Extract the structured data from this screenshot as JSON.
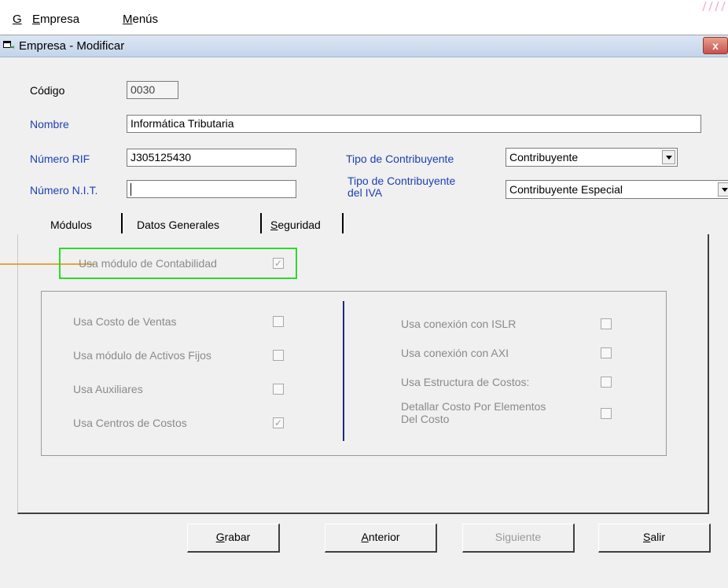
{
  "menu": {
    "items": [
      {
        "label": "G",
        "underline": "G",
        "rest": ""
      },
      {
        "label": "Empresa",
        "underline": "E",
        "rest": "mpresa"
      },
      {
        "label": "Menús",
        "underline": "M",
        "rest": "enús"
      }
    ]
  },
  "window": {
    "title": "Empresa - Modificar",
    "close_label": "x"
  },
  "form": {
    "codigo_label": "Código",
    "codigo_value": "0030",
    "nombre_label": "Nombre",
    "nombre_value": "Informática Tributaria",
    "rif_label": "Número RIF",
    "rif_value": "J305125430",
    "nit_label": "Número N.I.T.",
    "nit_value": "",
    "tipo_contribuyente_label": "Tipo de Contribuyente",
    "tipo_contribuyente_value": "Contribuyente",
    "tipo_iva_label_1": "Tipo de Contribuyente",
    "tipo_iva_label_2": "del IVA",
    "tipo_iva_value": "Contribuyente Especial"
  },
  "tabs": [
    {
      "label": "Módulos",
      "active": true
    },
    {
      "label": "Datos Generales",
      "active": false
    },
    {
      "label": "Seguridad",
      "underline": "S",
      "rest": "eguridad",
      "active": false
    }
  ],
  "modulos": {
    "usa_contabilidad_label": "Usa módulo de Contabilidad",
    "usa_contabilidad_checked": true,
    "left_options": [
      {
        "label": "Usa Costo de Ventas",
        "checked": false
      },
      {
        "label": "Usa módulo de Activos Fijos",
        "checked": false
      },
      {
        "label": "Usa Auxiliares",
        "checked": false
      },
      {
        "label": "Usa Centros de Costos",
        "checked": true
      }
    ],
    "right_options": [
      {
        "label": "Usa conexión con ISLR",
        "checked": false
      },
      {
        "label": "Usa conexión con AXI",
        "checked": false
      },
      {
        "label": "Usa Estructura de Costos:",
        "checked": false
      },
      {
        "label_1": "Detallar Costo Por Elementos",
        "label_2": "Del Costo",
        "checked": false
      }
    ],
    "check_glyph": "✓"
  },
  "buttons": {
    "grabar_u": "G",
    "grabar_rest": "rabar",
    "anterior_u": "A",
    "anterior_rest": "nterior",
    "siguiente": "Siguiente",
    "salir_u": "S",
    "salir_rest": "alir"
  },
  "colors": {
    "highlight": "#2ed82e",
    "callout": "#e8a43a",
    "label_blue": "#1e3fb4"
  }
}
